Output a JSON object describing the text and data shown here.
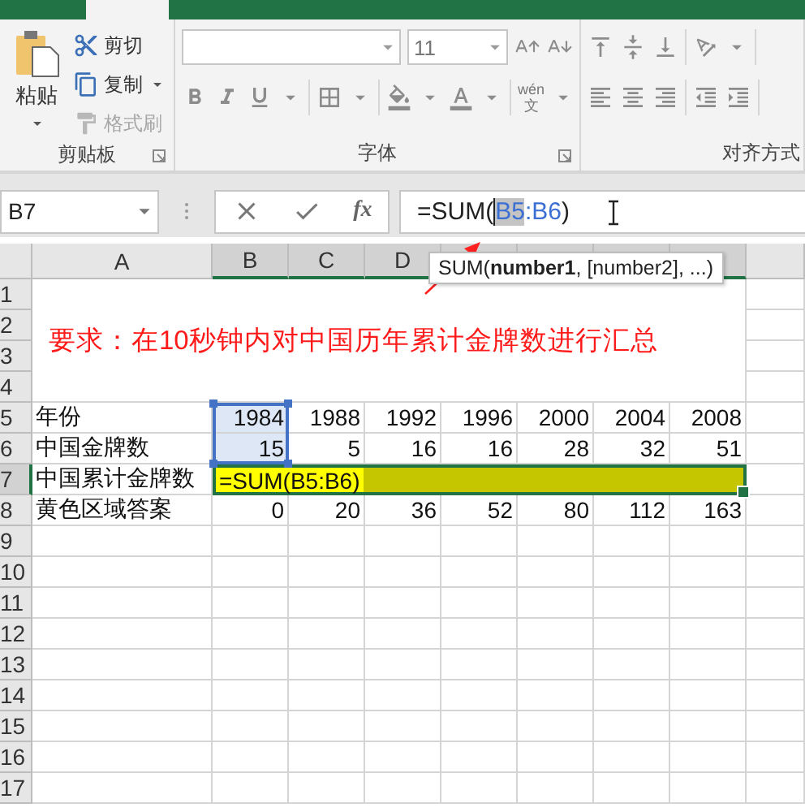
{
  "ribbon": {
    "clipboard": {
      "paste": "粘贴",
      "items": [
        {
          "kind": "cut",
          "label": "剪切",
          "disabled": false
        },
        {
          "kind": "copy",
          "label": "复制",
          "disabled": false
        },
        {
          "kind": "painter",
          "label": "格式刷",
          "disabled": true
        }
      ],
      "label": "剪贴板"
    },
    "font": {
      "font_size": "11",
      "phonetic": [
        "wén",
        "文"
      ],
      "label": "字体"
    },
    "alignment": {
      "label": "对齐方式"
    }
  },
  "formula_bar": {
    "name_box": "B7",
    "function_button": "fx",
    "parts": [
      {
        "kind": "plain",
        "text": "=SUM(",
        "selected": false
      },
      {
        "kind": "ref",
        "text": "B5",
        "selected": true
      },
      {
        "kind": "ref",
        "text": ":B6",
        "selected": false
      },
      {
        "kind": "plain",
        "text": ")",
        "selected": false
      }
    ]
  },
  "tooltip": "SUM(**number1**, [number2], ...)",
  "sheet": {
    "columns": [
      {
        "label": "A",
        "selected": false
      },
      {
        "label": "B",
        "selected": true
      },
      {
        "label": "C",
        "selected": true
      },
      {
        "label": "D",
        "selected": true
      }
    ],
    "title": "要求：在10秒钟内对中国历年累计金牌数进行汇总",
    "rows": [
      {
        "number": "1",
        "kind": "title",
        "selected": false
      },
      {
        "number": "2",
        "kind": "title",
        "selected": false
      },
      {
        "number": "3",
        "kind": "title",
        "selected": false
      },
      {
        "number": "4",
        "kind": "title",
        "selected": false
      },
      {
        "number": "5",
        "kind": "data",
        "selected": false,
        "cells": [
          {
            "text": "年份",
            "selected": false
          },
          {
            "text": "1984",
            "selected": true
          },
          {
            "text": "1988",
            "selected": false
          },
          {
            "text": "1992",
            "selected": false
          },
          {
            "text": "1996",
            "selected": false
          },
          {
            "text": "2000",
            "selected": false
          },
          {
            "text": "2004",
            "selected": false
          },
          {
            "text": "2008",
            "selected": false
          }
        ]
      },
      {
        "number": "6",
        "kind": "data",
        "selected": false,
        "cells": [
          {
            "text": "中国金牌数",
            "selected": false
          },
          {
            "text": "15",
            "selected": true
          },
          {
            "text": "5",
            "selected": false
          },
          {
            "text": "16",
            "selected": false
          },
          {
            "text": "16",
            "selected": false
          },
          {
            "text": "28",
            "selected": false
          },
          {
            "text": "32",
            "selected": false
          },
          {
            "text": "51",
            "selected": false
          }
        ]
      },
      {
        "number": "7",
        "kind": "entry",
        "selected": true,
        "label": "中国累计金牌数",
        "entry": "=SUM(B5:B6)",
        "highlighted": true
      },
      {
        "number": "8",
        "kind": "data",
        "selected": false,
        "cells": [
          {
            "text": "黄色区域答案",
            "selected": false
          },
          {
            "text": "0",
            "selected": false
          },
          {
            "text": "20",
            "selected": false
          },
          {
            "text": "36",
            "selected": false
          },
          {
            "text": "52",
            "selected": false
          },
          {
            "text": "80",
            "selected": false
          },
          {
            "text": "112",
            "selected": false
          },
          {
            "text": "163",
            "selected": false
          }
        ]
      },
      {
        "number": "9",
        "kind": "blank",
        "selected": false
      },
      {
        "number": "10",
        "kind": "blank",
        "selected": false
      },
      {
        "number": "11",
        "kind": "blank",
        "selected": false
      },
      {
        "number": "12",
        "kind": "blank",
        "selected": false
      },
      {
        "number": "13",
        "kind": "blank",
        "selected": false
      },
      {
        "number": "14",
        "kind": "blank",
        "selected": false
      },
      {
        "number": "15",
        "kind": "blank",
        "selected": false
      },
      {
        "number": "16",
        "kind": "blank",
        "selected": false
      },
      {
        "number": "17",
        "kind": "blank",
        "selected": false
      }
    ]
  }
}
